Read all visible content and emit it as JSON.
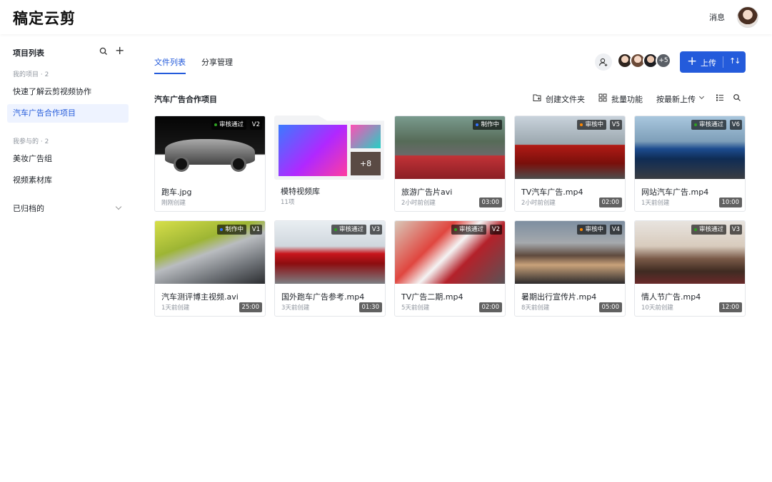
{
  "app": {
    "logo": "稿定云剪",
    "messages": "消息"
  },
  "sidebar": {
    "title": "项目列表",
    "my_group": "我的项目 · 2",
    "my_items": [
      "快速了解云剪视频协作",
      "汽车广告合作项目"
    ],
    "joined_group": "我参与的 · 2",
    "joined_items": [
      "美妆广告组",
      "视频素材库"
    ],
    "archived": "已归档的"
  },
  "tabs": [
    "文件列表",
    "分享管理"
  ],
  "collaborators_more": "+5",
  "upload_label": "上传",
  "project_title": "汽车广告合作项目",
  "toolbar": {
    "create_folder": "创建文件夹",
    "batch": "批量功能",
    "sort": "按最新上传"
  },
  "status_colors": {
    "approved": "#2ea121",
    "in_progress": "#3370ff",
    "review": "#ff8800"
  },
  "cards": [
    {
      "name": "跑车.jpg",
      "meta": "刚刚创建",
      "status": "审核通过",
      "status_color": "#2ea121",
      "version": "V2",
      "duration": ""
    },
    {
      "name": "模特视频库",
      "meta": "11项",
      "status": "",
      "status_color": "",
      "version": "",
      "duration": "",
      "folder_more": "+8"
    },
    {
      "name": "旅游广告片avi",
      "meta": "2小时前创建",
      "status": "制作中",
      "status_color": "#3370ff",
      "version": "",
      "duration": "03:00"
    },
    {
      "name": "TV汽车广告.mp4",
      "meta": "2小时前创建",
      "status": "审核中",
      "status_color": "#ff8800",
      "version": "V5",
      "duration": "02:00"
    },
    {
      "name": "网站汽车广告.mp4",
      "meta": "1天前创建",
      "status": "审核通过",
      "status_color": "#2ea121",
      "version": "V6",
      "duration": "10:00"
    },
    {
      "name": "汽车测评博主视频.avi",
      "meta": "1天前创建",
      "status": "制作中",
      "status_color": "#3370ff",
      "version": "V1",
      "duration": "25:00"
    },
    {
      "name": "国外跑车广告参考.mp4",
      "meta": "3天前创建",
      "status": "审核通过",
      "status_color": "#2ea121",
      "version": "V3",
      "duration": "01:30"
    },
    {
      "name": "TV广告二期.mp4",
      "meta": "5天前创建",
      "status": "审核通过",
      "status_color": "#2ea121",
      "version": "V2",
      "duration": "02:00"
    },
    {
      "name": "暑期出行宣传片.mp4",
      "meta": "8天前创建",
      "status": "审核中",
      "status_color": "#ff8800",
      "version": "V4",
      "duration": "05:00"
    },
    {
      "name": "情人节广告.mp4",
      "meta": "10天前创建",
      "status": "审核通过",
      "status_color": "#2ea121",
      "version": "V3",
      "duration": "12:00"
    }
  ]
}
